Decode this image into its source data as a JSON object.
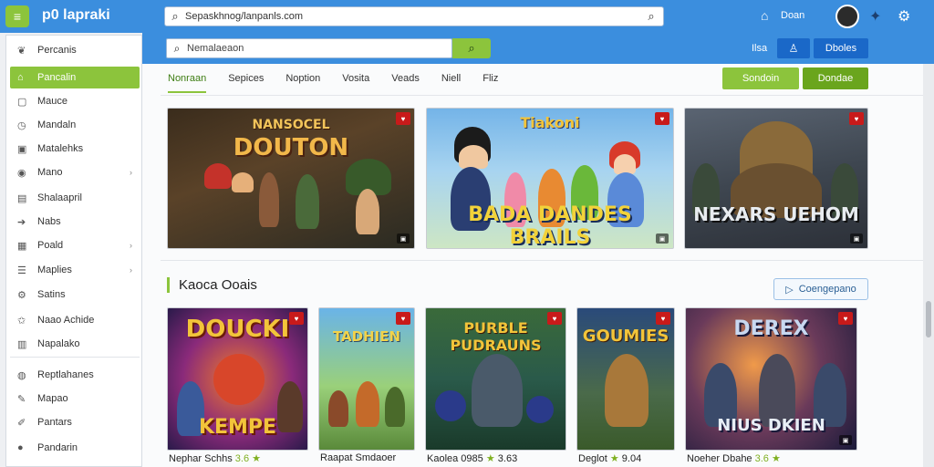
{
  "app": {
    "brand": "p0 lapraki",
    "logo_glyph": "≡"
  },
  "topbar": {
    "search_value": "Sepaskhnog/lanpanls.com",
    "home_label": "Doan"
  },
  "subbar": {
    "search_value": "Nemalaeaon",
    "label": "Ilsa",
    "btn2_label": "Dboles"
  },
  "sidebar": {
    "items": [
      {
        "label": "Percanis",
        "icon": "leaf-icon",
        "chevron": false
      },
      {
        "label": "Pancalin",
        "icon": "home-icon",
        "chevron": false
      },
      {
        "label": "Mauce",
        "icon": "square-icon",
        "chevron": false
      },
      {
        "label": "Mandaln",
        "icon": "clock-icon",
        "chevron": false
      },
      {
        "label": "Matalehks",
        "icon": "chat-icon",
        "chevron": false
      },
      {
        "label": "Mano",
        "icon": "gamepad-icon",
        "chevron": true
      },
      {
        "label": "Shalaapril",
        "icon": "document-icon",
        "chevron": false
      },
      {
        "label": "Nabs",
        "icon": "arrow-icon",
        "chevron": false
      },
      {
        "label": "Poald",
        "icon": "grid-icon",
        "chevron": true
      },
      {
        "label": "Maplies",
        "icon": "list-icon",
        "chevron": true
      },
      {
        "label": "Satins",
        "icon": "settings-icon",
        "chevron": false
      },
      {
        "label": "Naao Achide",
        "icon": "star-icon",
        "chevron": false
      },
      {
        "label": "Napalako",
        "icon": "table-icon",
        "chevron": false
      },
      {
        "label": "Reptlahanes",
        "icon": "globe-icon",
        "chevron": false
      },
      {
        "label": "Mapao",
        "icon": "pencil-icon",
        "chevron": false
      },
      {
        "label": "Pantars",
        "icon": "brush-icon",
        "chevron": false
      },
      {
        "label": "Pandarin",
        "icon": "circle-icon",
        "chevron": false
      }
    ],
    "active_index": 1
  },
  "main": {
    "tabs": [
      {
        "label": "Nonraan",
        "active": true
      },
      {
        "label": "Sepices",
        "active": false
      },
      {
        "label": "Noption",
        "active": false
      },
      {
        "label": "Vosita",
        "active": false
      },
      {
        "label": "Veads",
        "active": false
      },
      {
        "label": "Niell",
        "active": false
      },
      {
        "label": "Fliz",
        "active": false
      }
    ],
    "btn_green1": "Sondoin",
    "btn_green2": "Dondae",
    "featured": [
      {
        "title": "DOUTON",
        "subtitle": "NANSOCEL"
      },
      {
        "title": "BADA DANDES BRAILS",
        "subtitle": "Tiakoni"
      },
      {
        "title": "NEXARS UEHOM",
        "subtitle": ""
      }
    ],
    "section_title": "Kaoca Ooais",
    "section_button": "Coengepano",
    "games": [
      {
        "art": "DOUCKI",
        "art2": "KEMPE",
        "caption": "Nephar Schhs",
        "rating": "3.6"
      },
      {
        "art": "TADHIEN",
        "art2": "",
        "caption": "Raapat Smdaoer",
        "rating": ""
      },
      {
        "art": "PURBLE PUDRAUNS",
        "art2": "",
        "caption": "Kaolea 0985",
        "rating": "3.63"
      },
      {
        "art": "GOUMIES",
        "art2": "",
        "caption": "Deglot",
        "rating": "9.04"
      },
      {
        "art": "DEREX",
        "art2": "NIUS DKIEN",
        "caption": "Noeher Dbahe",
        "rating": "3.6"
      }
    ]
  },
  "colors": {
    "topbar": "#3b8ede",
    "accent": "#8cc43c",
    "primary_button": "#1a68c8",
    "badge": "#c81a1a"
  }
}
